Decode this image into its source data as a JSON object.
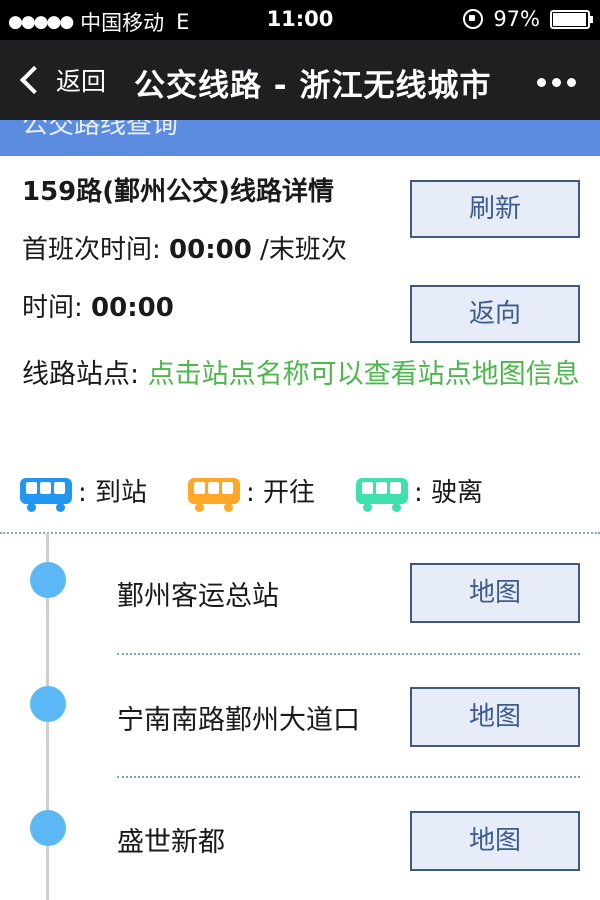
{
  "status_bar": {
    "carrier": "中国移动",
    "network": "E",
    "time": "11:00",
    "battery": "97%",
    "battery_level": 0.97
  },
  "nav": {
    "back_label": "返回",
    "title": "公交线路 - 浙江无线城市"
  },
  "section_header": "公交路线查询",
  "line": {
    "title": "159路(鄞州公交)线路详情",
    "first_label": "首班次时间: ",
    "first_time": "00:00",
    "sep": " /末班次",
    "last_label": "时间: ",
    "last_time": "00:00"
  },
  "buttons": {
    "refresh": "刷新",
    "reverse": "返向"
  },
  "stops_label": {
    "label": "线路站点: ",
    "hint": "点击站点名称可以查看站点地图信息"
  },
  "legend": [
    {
      "label": ": 到站",
      "color": "#2196f3"
    },
    {
      "label": ": 开往",
      "color": "#ffa726"
    },
    {
      "label": ": 驶离",
      "color": "#3fe0b0"
    }
  ],
  "stops": [
    {
      "name": "鄞州客运总站",
      "map_label": "地图"
    },
    {
      "name": "宁南南路鄞州大道口",
      "map_label": "地图"
    },
    {
      "name": "盛世新都",
      "map_label": "地图"
    }
  ]
}
